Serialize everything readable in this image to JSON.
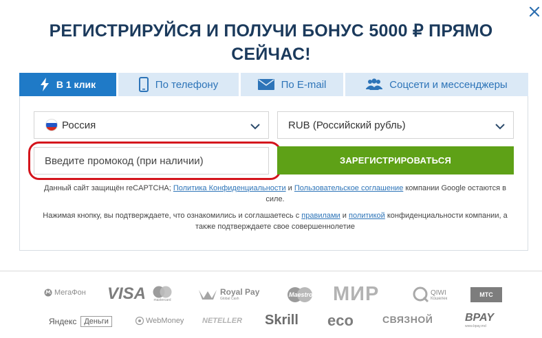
{
  "modal": {
    "title": "РЕГИСТРИРУЙСЯ И ПОЛУЧИ БОНУС 5000 ₽ ПРЯМО СЕЙЧАС!"
  },
  "tabs": [
    {
      "label": "В 1 клик",
      "icon": "lightning-icon",
      "active": true
    },
    {
      "label": "По телефону",
      "icon": "phone-icon",
      "active": false
    },
    {
      "label": "По E-mail",
      "icon": "envelope-icon",
      "active": false
    },
    {
      "label": "Соцсети и мессенджеры",
      "icon": "users-icon",
      "active": false
    }
  ],
  "form": {
    "country": "Россия",
    "currency": "RUB (Российский рубль)",
    "promo_placeholder": "Введите промокод (при наличии)",
    "register_label": "ЗАРЕГИСТРИРОВАТЬСЯ"
  },
  "notes": {
    "captcha_pre": "Данный сайт защищён reCAPTCHA;",
    "privacy_link": "Политика Конфиденциальности",
    "and": "и",
    "terms_link": "Пользовательское соглашение",
    "captcha_post": "компании Google остаются в силе.",
    "consent_pre": "Нажимая кнопку, вы подтверждаете, что ознакомились и соглашаетесь с",
    "rules_link": "правилами",
    "policy_link": "политикой",
    "consent_post": "конфиденциальности компании, а также подтверждаете свое совершеннолетие"
  },
  "payments": {
    "megafon": "МегаФон",
    "visa": "VISA",
    "mastercard": "mastercard",
    "royalpay": "Royal Pay",
    "royalpay_sub": "Global Cash",
    "maestro": "Maestro",
    "mir": "МИР",
    "qiwi": "QIWI",
    "qiwi_sub": "Кошелек",
    "mts": "МТС",
    "yandex": "Яндекс",
    "dengi": "Деньги",
    "webmoney": "WebMoney",
    "neteller": "NETELLER",
    "skrill": "Skrill",
    "eco": "eco",
    "svyaznoy": "СВЯЗНОЙ",
    "bpay": "BPAY",
    "bpay_sub": "www.bpay.md"
  },
  "colors": {
    "title": "#1b3a5c",
    "tab_active": "#1f7ac7",
    "tab_inactive_bg": "#dbe9f6",
    "link": "#2d74b8",
    "register": "#5ea117",
    "highlight": "#d4141c"
  }
}
